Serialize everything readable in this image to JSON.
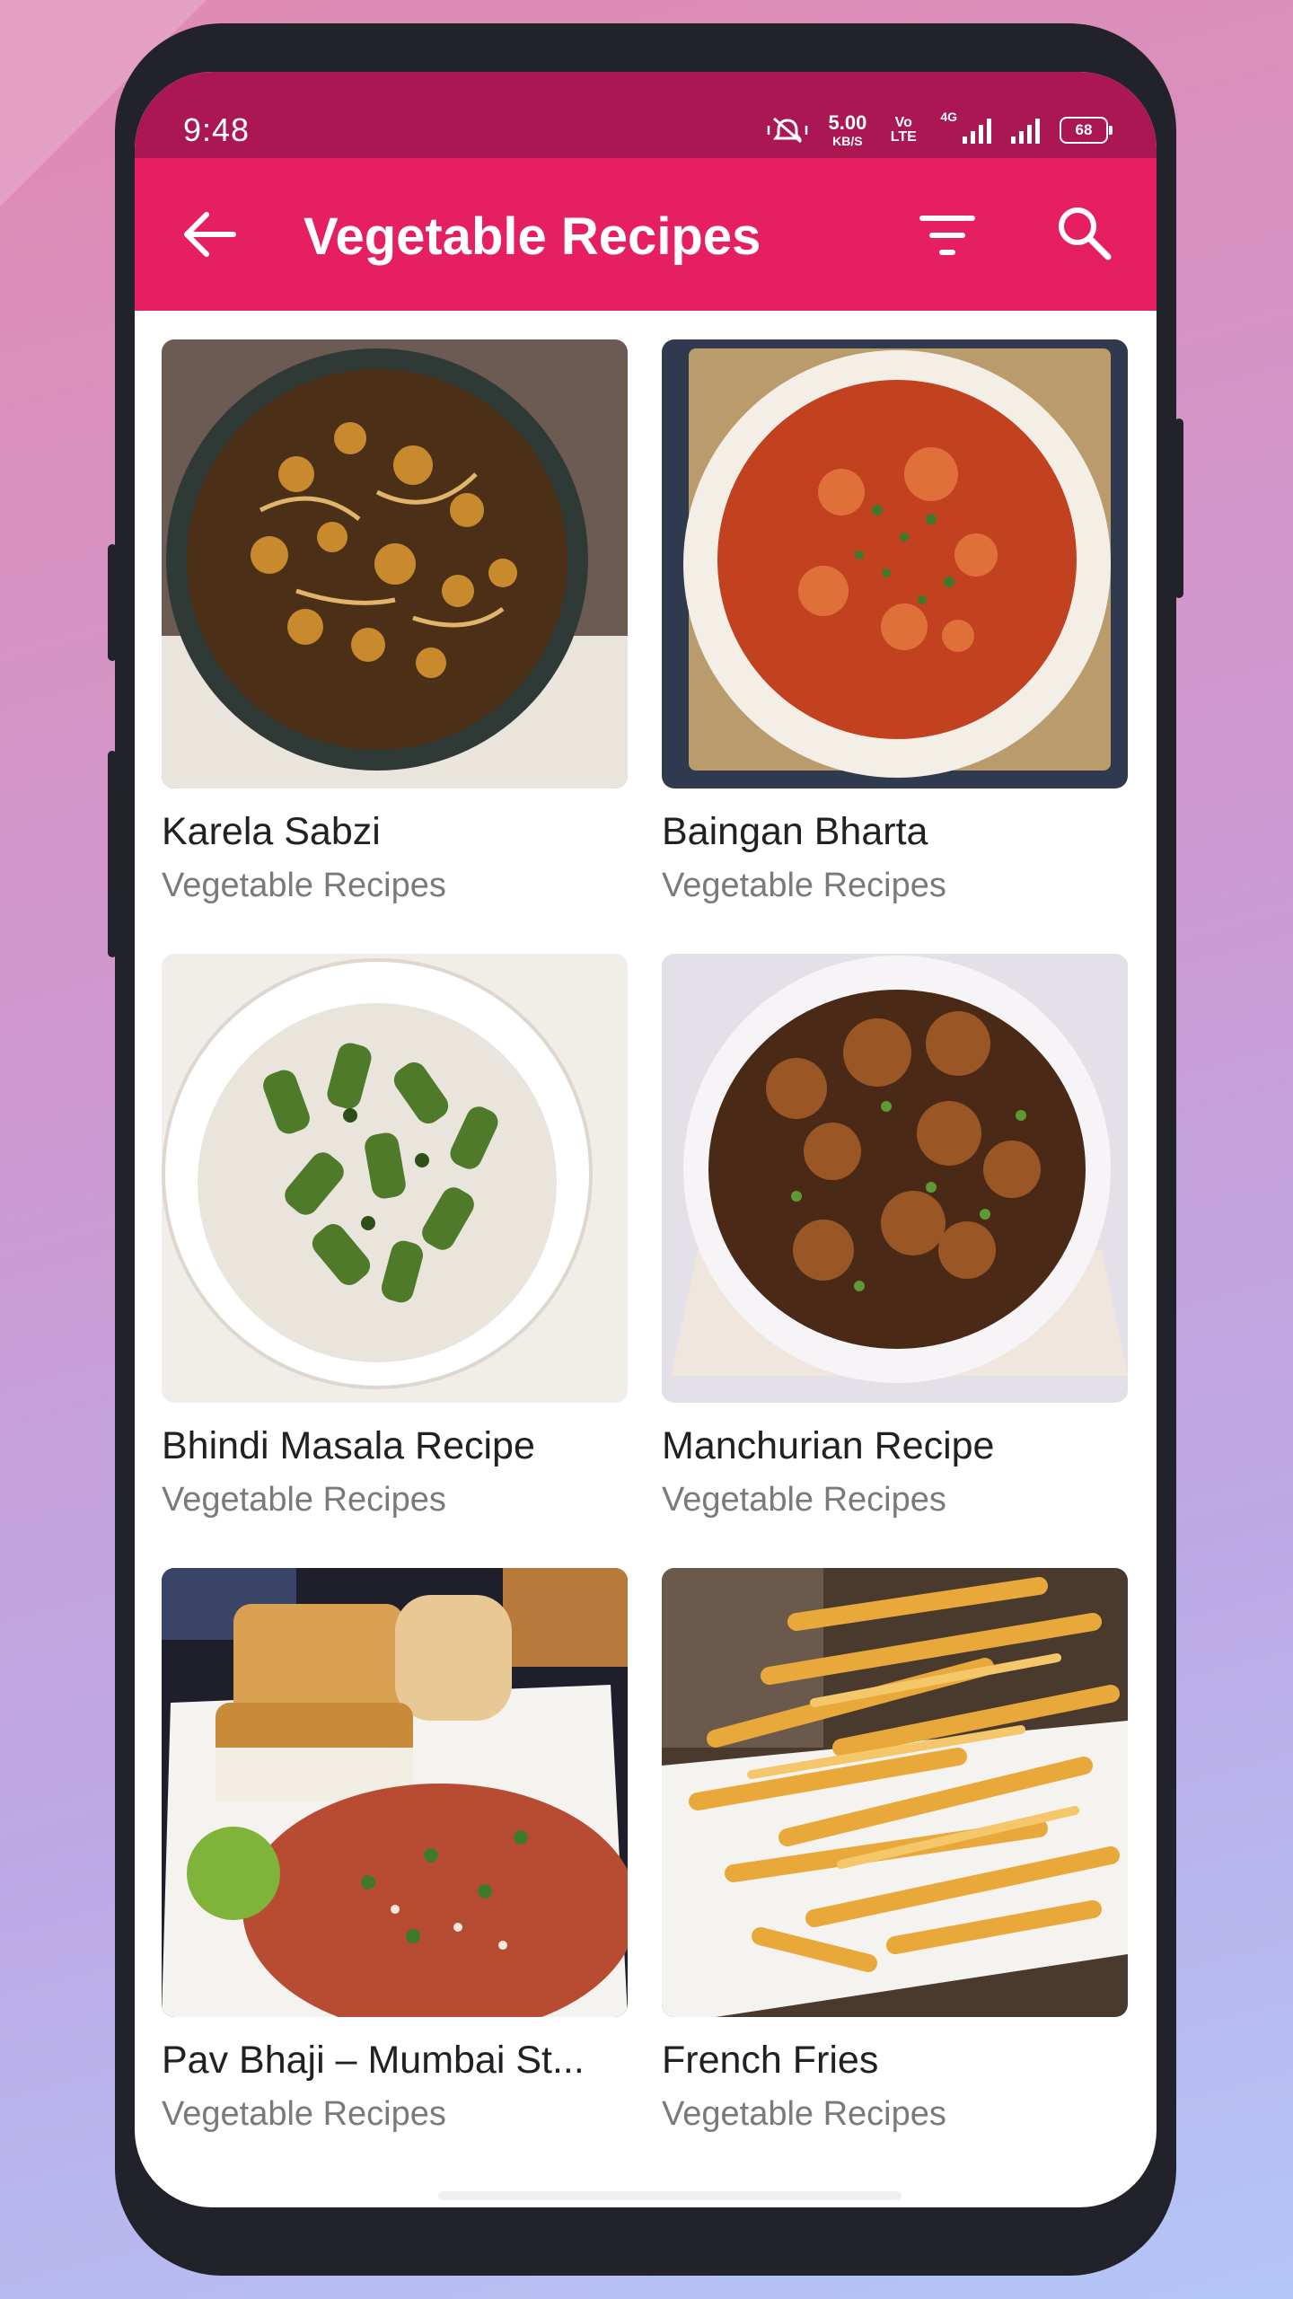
{
  "status_bar": {
    "time": "9:48",
    "speed_value": "5.00",
    "speed_unit": "KB/S",
    "volte": "Vo LTE",
    "network": "4G",
    "battery": "68"
  },
  "app_bar": {
    "title": "Vegetable Recipes",
    "back_icon": "arrow-left-icon",
    "filter_icon": "filter-icon",
    "search_icon": "search-icon"
  },
  "colors": {
    "status_bar": "#aa1752",
    "app_bar": "#e61f63",
    "title_text": "#202124",
    "subtitle_text": "#7a7a7a"
  },
  "recipes": [
    {
      "title": "Karela Sabzi",
      "category": "Vegetable Recipes",
      "image": "karela-sabzi-photo"
    },
    {
      "title": "Baingan Bharta",
      "category": "Vegetable Recipes",
      "image": "baingan-bharta-photo"
    },
    {
      "title": "Bhindi Masala Recipe",
      "category": "Vegetable Recipes",
      "image": "bhindi-masala-photo"
    },
    {
      "title": "Manchurian Recipe",
      "category": "Vegetable Recipes",
      "image": "manchurian-photo"
    },
    {
      "title": "Pav Bhaji – Mumbai St...",
      "category": "Vegetable Recipes",
      "image": "pav-bhaji-photo"
    },
    {
      "title": "French Fries",
      "category": "Vegetable Recipes",
      "image": "french-fries-photo"
    }
  ]
}
